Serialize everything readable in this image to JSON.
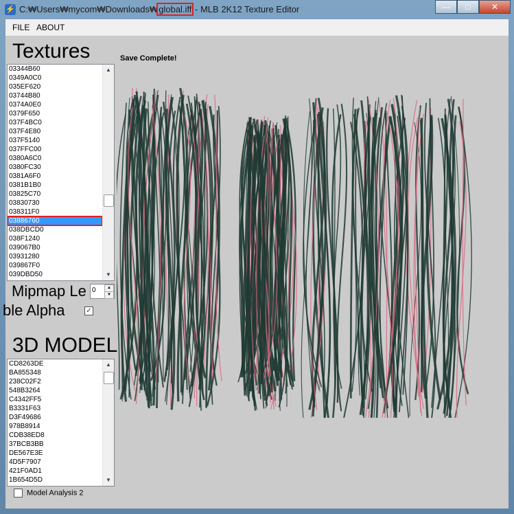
{
  "window": {
    "title_prefix": "C:₩Users₩mycom₩Downloads₩",
    "title_highlight": "global.iff",
    "title_suffix": " - MLB 2K12 Texture Editor",
    "minimize_glyph": "—",
    "maximize_glyph": "□",
    "close_glyph": "✕"
  },
  "menu": {
    "file": "FILE",
    "about": "ABOUT"
  },
  "textures": {
    "heading": "Textures",
    "items": [
      "03344B60",
      "0349A0C0",
      "035EF620",
      "03744B80",
      "0374A0E0",
      "0379F650",
      "037F4BC0",
      "037F4E80",
      "037F5140",
      "037FFC00",
      "0380A6C0",
      "0380FC30",
      "0381A6F0",
      "0381B1B0",
      "03825C70",
      "03830730",
      "038311F0",
      "03886760",
      "038DBCD0",
      "038F1240",
      "039067B0",
      "03931280",
      "039867F0",
      "039DBD50"
    ],
    "selected_index": 17
  },
  "mipmap": {
    "label": "Mipmap Le",
    "value": "0"
  },
  "alpha": {
    "label": "ble Alpha",
    "checked": true,
    "check_glyph": "✓"
  },
  "models": {
    "heading": "3D MODEL",
    "items": [
      "CD8263DE",
      "BA855348",
      "238C02F2",
      "548B3264",
      "C4342FF5",
      "B3331F63",
      "D3F49686",
      "978B8914",
      "CDB38ED8",
      "37BCB3BB",
      "DE567E3E",
      "4D5F7907",
      "421F0AD1",
      "1B654D5D"
    ]
  },
  "status": "Save Complete!",
  "model_analysis": {
    "label": "Model Analysis 2",
    "checked": false
  },
  "preview": {
    "hair_base": "#1f3a33",
    "hair_highlight": "#d86a80",
    "background": "#cbcbcb"
  }
}
